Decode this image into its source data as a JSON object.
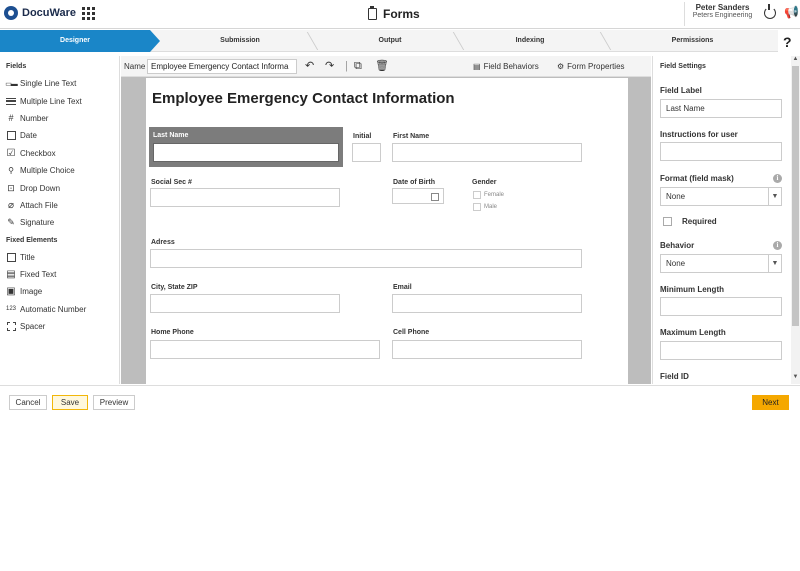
{
  "header": {
    "brand": "DocuWare",
    "app_title": "Forms",
    "user_name": "Peter Sanders",
    "user_org": "Peters Engineering"
  },
  "steps": [
    "Designer",
    "Submission",
    "Output",
    "Indexing",
    "Permissions"
  ],
  "help": "?",
  "left_panel": {
    "fields_heading": "Fields",
    "fields": [
      {
        "label": "Single Line Text",
        "icon": "single-line-text-icon"
      },
      {
        "label": "Multiple Line Text",
        "icon": "multi-line-text-icon"
      },
      {
        "label": "Number",
        "icon": "number-icon"
      },
      {
        "label": "Date",
        "icon": "date-icon"
      },
      {
        "label": "Checkbox",
        "icon": "checkbox-icon"
      },
      {
        "label": "Multiple Choice",
        "icon": "multiple-choice-icon"
      },
      {
        "label": "Drop Down",
        "icon": "drop-down-icon"
      },
      {
        "label": "Attach File",
        "icon": "paperclip-icon"
      },
      {
        "label": "Signature",
        "icon": "signature-icon"
      }
    ],
    "fixed_heading": "Fixed Elements",
    "fixed": [
      {
        "label": "Title",
        "icon": "title-icon"
      },
      {
        "label": "Fixed Text",
        "icon": "fixed-text-icon"
      },
      {
        "label": "Image",
        "icon": "image-icon"
      },
      {
        "label": "Automatic Number",
        "icon": "auto-number-icon"
      },
      {
        "label": "Spacer",
        "icon": "spacer-icon"
      }
    ]
  },
  "toolbar": {
    "name_label": "Name",
    "name_value": "Employee Emergency Contact Informa",
    "field_behaviors": "Field Behaviors",
    "form_properties": "Form Properties"
  },
  "form": {
    "title": "Employee Emergency Contact Information",
    "last_name": "Last Name",
    "initial": "Initial",
    "first_name": "First Name",
    "social_sec": "Social Sec #",
    "date_of_birth": "Date of Birth",
    "gender": "Gender",
    "female": "Female",
    "male": "Male",
    "address": "Adress",
    "city_state_zip": "City, State ZIP",
    "email": "Email",
    "home_phone": "Home Phone",
    "cell_phone": "Cell Phone"
  },
  "field_settings": {
    "heading": "Field Settings",
    "field_label": "Field Label",
    "field_label_value": "Last Name",
    "instructions": "Instructions for user",
    "format": "Format (field mask)",
    "format_value": "None",
    "required": "Required",
    "behavior": "Behavior",
    "behavior_value": "None",
    "min_length": "Minimum Length",
    "max_length": "Maximum Length",
    "field_id": "Field ID"
  },
  "footer": {
    "cancel": "Cancel",
    "save": "Save",
    "preview": "Preview",
    "next": "Next"
  },
  "colors": {
    "accent": "#1a86c8",
    "next_button": "#f5a800",
    "brand": "#1d4f91"
  }
}
